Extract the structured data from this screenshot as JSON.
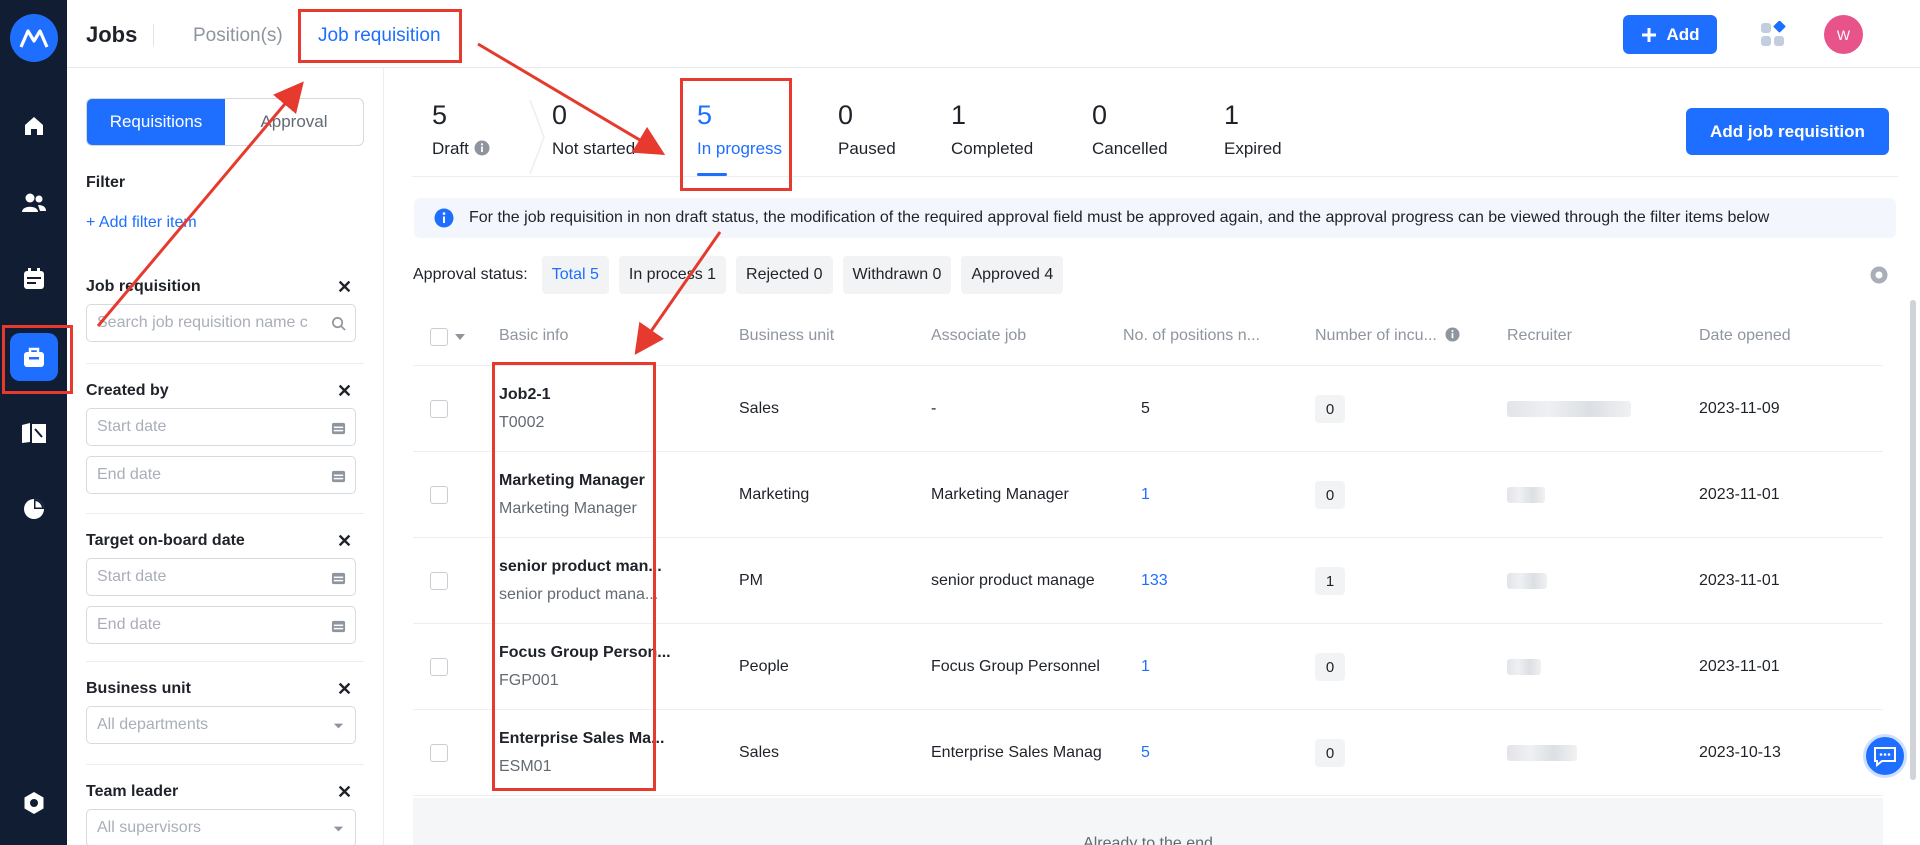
{
  "header": {
    "title": "Jobs",
    "tabs": [
      {
        "label": "Position(s)",
        "active": false
      },
      {
        "label": "Job requisition",
        "active": true
      }
    ],
    "add_button": "Add",
    "avatar_initial": "W"
  },
  "rail": {
    "icons": [
      "home-icon",
      "people-icon",
      "calendar-icon",
      "briefcase-icon",
      "book-icon",
      "pie-chart-icon",
      "settings-icon"
    ],
    "active": "briefcase-icon"
  },
  "filter": {
    "segments": [
      {
        "label": "Requisitions",
        "active": true
      },
      {
        "label": "Approval",
        "active": false
      }
    ],
    "title": "Filter",
    "add_filter": "Add filter item",
    "groups": [
      {
        "label": "Job requisition",
        "inputs": [
          "Search job requisition name c"
        ]
      },
      {
        "label": "Created by",
        "inputs": [
          "Start date",
          "End date"
        ]
      },
      {
        "label": "Target on-board date",
        "inputs": [
          "Start date",
          "End date"
        ]
      },
      {
        "label": "Business unit",
        "inputs": [
          "All departments"
        ]
      },
      {
        "label": "Team leader",
        "inputs": [
          "All supervisors"
        ]
      }
    ]
  },
  "stats": [
    {
      "num": "5",
      "label": "Draft"
    },
    {
      "num": "0",
      "label": "Not started"
    },
    {
      "num": "5",
      "label": "In progress",
      "active": true
    },
    {
      "num": "0",
      "label": "Paused"
    },
    {
      "num": "1",
      "label": "Completed"
    },
    {
      "num": "0",
      "label": "Cancelled"
    },
    {
      "num": "1",
      "label": "Expired"
    }
  ],
  "add_requisition_button": "Add job requisition",
  "notice": "For the job requisition in non draft status, the modification of the required approval field must be approved again, and the approval progress can be viewed through the filter items below",
  "approval": {
    "label": "Approval status:",
    "chips": [
      "Total 5",
      "In process 1",
      "Rejected 0",
      "Withdrawn 0",
      "Approved 4"
    ]
  },
  "table": {
    "columns": [
      "Basic info",
      "Business unit",
      "Associate job",
      "No. of positions n...",
      "Number of incu...",
      "Recruiter",
      "Date opened"
    ],
    "rows": [
      {
        "name": "Job2-1",
        "code": "T0002",
        "unit": "Sales",
        "job": "-",
        "positions": "5",
        "positions_link": false,
        "incumbents": "0",
        "date": "2023-11-09"
      },
      {
        "name": "Marketing Manager",
        "code": "Marketing Manager",
        "unit": "Marketing",
        "job": "Marketing Manager",
        "positions": "1",
        "positions_link": true,
        "incumbents": "0",
        "date": "2023-11-01"
      },
      {
        "name": "senior product man...",
        "code": "senior product mana...",
        "unit": "PM",
        "job": "senior product manage",
        "positions": "133",
        "positions_link": true,
        "incumbents": "1",
        "date": "2023-11-01"
      },
      {
        "name": "Focus Group Person...",
        "code": "FGP001",
        "unit": "People",
        "job": "Focus Group Personnel",
        "positions": "1",
        "positions_link": true,
        "incumbents": "0",
        "date": "2023-11-01"
      },
      {
        "name": "Enterprise Sales Ma...",
        "code": "ESM01",
        "unit": "Sales",
        "job": "Enterprise Sales Manag",
        "positions": "5",
        "positions_link": true,
        "incumbents": "0",
        "date": "2023-10-13"
      }
    ],
    "footer": "Already to the end"
  },
  "colors": {
    "accent": "#1e6fff",
    "rail": "#111d33",
    "annotation": "#e53a2d"
  }
}
